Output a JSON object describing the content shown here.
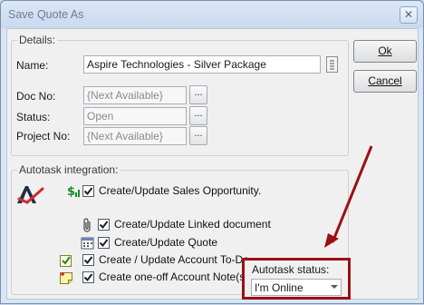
{
  "window": {
    "title": "Save Quote As",
    "close_glyph": "✕"
  },
  "buttons": {
    "ok_label": "Ok",
    "cancel_label": "Cancel",
    "browse_label": "..."
  },
  "details": {
    "group_label": "Details:",
    "name_label": "Name:",
    "name_value": "Aspire Technologies - Silver Package",
    "doc_label": "Doc No:",
    "doc_value": "{Next Available}",
    "status_label": "Status:",
    "status_value": "Open",
    "project_label": "Project No:",
    "project_value": "{Next Available}"
  },
  "autotask": {
    "group_label": "Autotask integration:",
    "options": [
      {
        "label": "Create/Update Sales Opportunity.",
        "checked": true,
        "icon": "dollar-sign-icon"
      },
      {
        "label": "Create/Update Linked document",
        "checked": true,
        "icon": "paperclip-icon"
      },
      {
        "label": "Create/Update Quote",
        "checked": true,
        "icon": "calendar-icon"
      },
      {
        "label": "Create / Update Account To-Do",
        "checked": true,
        "icon": "todo-check-icon"
      },
      {
        "label": "Create one-off Account Note(s)",
        "checked": true,
        "icon": "note-icon"
      }
    ],
    "status_label": "Autotask status:",
    "status_value": "I'm Online"
  },
  "colors": {
    "highlight_red": "#9b1016",
    "titlebar": "#d3e2f3",
    "window_bg": "#f0f0f0"
  }
}
